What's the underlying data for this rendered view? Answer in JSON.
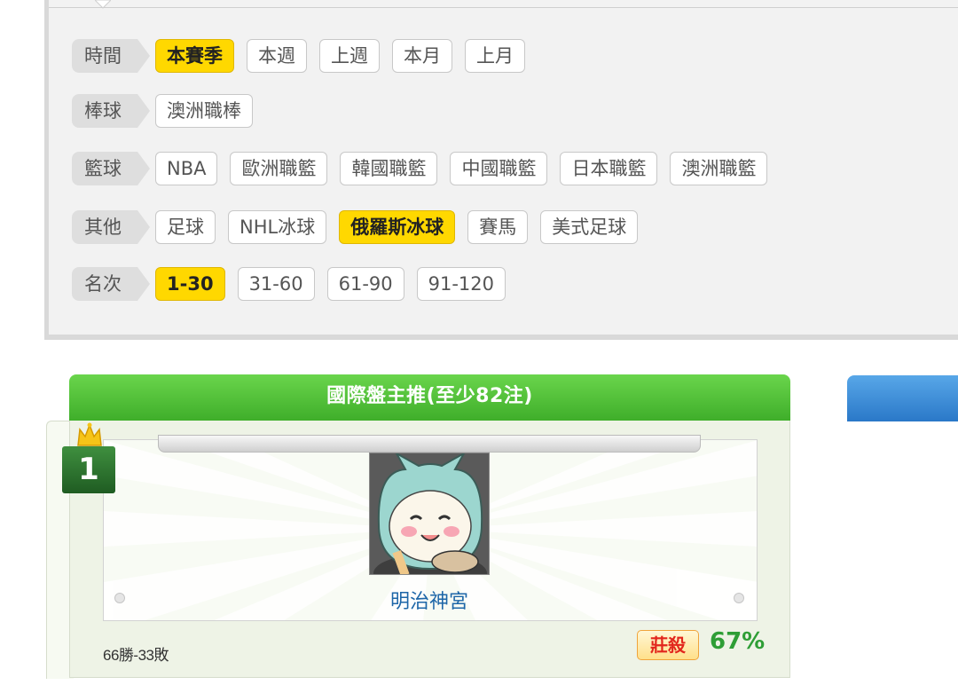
{
  "filters": {
    "rows": [
      {
        "label": "時間",
        "chips": [
          {
            "text": "本賽季",
            "active": true
          },
          {
            "text": "本週",
            "active": false
          },
          {
            "text": "上週",
            "active": false
          },
          {
            "text": "本月",
            "active": false
          },
          {
            "text": "上月",
            "active": false
          }
        ]
      },
      {
        "label": "棒球",
        "chips": [
          {
            "text": "澳洲職棒",
            "active": false
          }
        ]
      },
      {
        "label": "籃球",
        "chips": [
          {
            "text": "NBA",
            "active": false
          },
          {
            "text": "歐洲職籃",
            "active": false
          },
          {
            "text": "韓國職籃",
            "active": false
          },
          {
            "text": "中國職籃",
            "active": false
          },
          {
            "text": "日本職籃",
            "active": false
          },
          {
            "text": "澳洲職籃",
            "active": false
          }
        ]
      },
      {
        "label": "其他",
        "chips": [
          {
            "text": "足球",
            "active": false
          },
          {
            "text": "NHL冰球",
            "active": false
          },
          {
            "text": "俄羅斯冰球",
            "active": true
          },
          {
            "text": "賽馬",
            "active": false
          },
          {
            "text": "美式足球",
            "active": false
          }
        ]
      },
      {
        "label": "名次",
        "chips": [
          {
            "text": "1-30",
            "active": true
          },
          {
            "text": "31-60",
            "active": false
          },
          {
            "text": "61-90",
            "active": false
          },
          {
            "text": "91-120",
            "active": false
          }
        ]
      }
    ]
  },
  "ranking": {
    "title": "國際盤主推(至少82注)",
    "rank": "1",
    "user_name": "明治神宮",
    "record": "66勝-33敗",
    "tag": "莊殺",
    "percent": "67%"
  },
  "colors": {
    "active_chip": "#ffd800",
    "header_green": "#4cbf35",
    "percent_green": "#2e9e36",
    "name_blue": "#1d66a8",
    "side_tab_blue": "#3a8ad8"
  }
}
